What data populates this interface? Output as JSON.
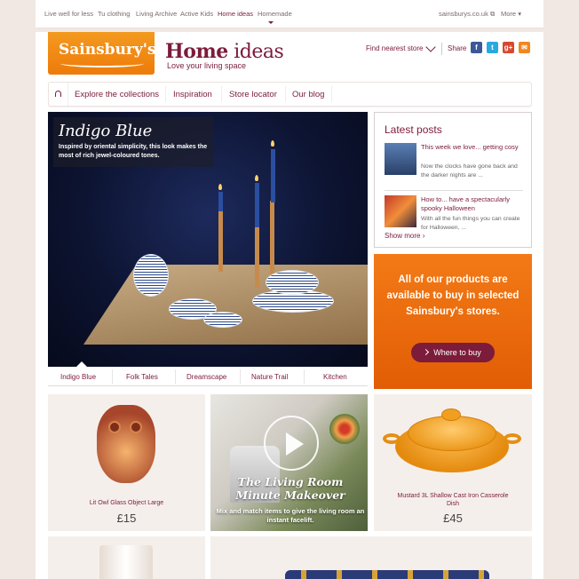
{
  "topnav": {
    "links": [
      "Live well for less",
      "Tu clothing",
      "Living Archive",
      "Active Kids",
      "Home ideas",
      "Homemade"
    ],
    "active": "Home ideas",
    "site_link": "sainsburys.co.uk",
    "more": "More"
  },
  "header": {
    "logo": "Sainsbury's",
    "title_bold": "Home",
    "title_light": " ideas",
    "tagline": "Love your living space",
    "find_store": "Find nearest store",
    "share": "Share",
    "social_icons": [
      "facebook-icon",
      "twitter-icon",
      "googleplus-icon",
      "email-icon"
    ],
    "colors": {
      "facebook": "#3b5998",
      "twitter": "#29a9e0",
      "googleplus": "#d6492f",
      "email": "#f0871f"
    }
  },
  "mainnav": {
    "items": [
      "Explore the collections",
      "Inspiration",
      "Store locator",
      "Our blog"
    ]
  },
  "hero": {
    "title": "Indigo Blue",
    "description": "Inspired by oriental simplicity, this look makes the most of rich jewel-coloured tones."
  },
  "tabs": [
    "Indigo Blue",
    "Folk Tales",
    "Dreamscape",
    "Nature Trail",
    "Kitchen"
  ],
  "latest_posts": {
    "heading": "Latest posts",
    "posts": [
      {
        "title": "This week we love... getting cosy",
        "desc": "Now the clocks have gone back and the darker nights are ..."
      },
      {
        "title": "How to... have a spectacularly spooky Halloween",
        "desc": "With all the fun things you can create for Halloween, ..."
      }
    ],
    "show_more": "Show more"
  },
  "promo": {
    "text": "All of our products are available to buy in selected Sainsbury's stores.",
    "button": "Where to buy"
  },
  "products": [
    {
      "name": "Lit Owl Glass Object Large",
      "price": "£15"
    },
    {
      "title": "The Living Room Minute Makeover",
      "desc": "Mix and match items to give the living room an instant facelift."
    },
    {
      "name": "Mustard 3L Shallow Cast Iron Casserole Dish",
      "price": "£45"
    }
  ],
  "brand_colors": {
    "primary": "#7c1b3a",
    "orange": "#ee7b0a"
  }
}
